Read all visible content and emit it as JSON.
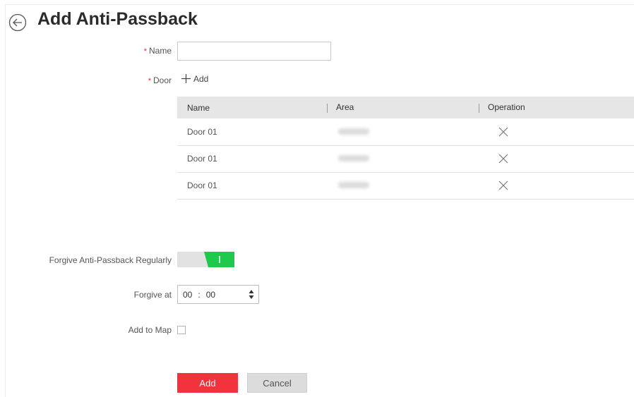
{
  "page": {
    "title": "Add Anti-Passback"
  },
  "form": {
    "name_label": "Name",
    "name_value": "",
    "required_mark": "*",
    "door_label": "Door",
    "add_door_label": "Add",
    "forgive_label": "Forgive Anti-Passback Regularly",
    "forgive_enabled": true,
    "forgive_at_label": "Forgive at",
    "forgive_hour": "00",
    "forgive_minute": "00",
    "time_separator": ":",
    "add_to_map_label": "Add to Map",
    "add_to_map_checked": false
  },
  "table": {
    "headers": [
      "Name",
      "Area",
      "Operation"
    ],
    "rows": [
      {
        "name": "Door 01",
        "area": "",
        "operation_icon": "close-icon"
      },
      {
        "name": "Door 01",
        "area": "",
        "operation_icon": "close-icon"
      },
      {
        "name": "Door 01",
        "area": "",
        "operation_icon": "close-icon"
      }
    ]
  },
  "buttons": {
    "add": "Add",
    "cancel": "Cancel"
  },
  "colors": {
    "accent_red": "#f2323c",
    "toggle_green": "#1ec94c",
    "required_red": "#e8282e"
  }
}
